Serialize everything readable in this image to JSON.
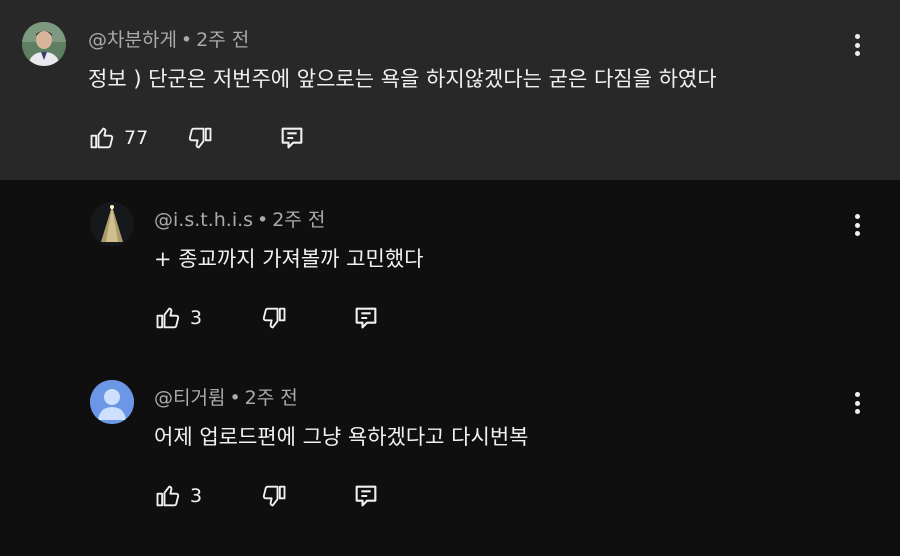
{
  "separator": "•",
  "comments": [
    {
      "handle": "@차분하게",
      "time": "2주 전",
      "text": "정보 )  단군은 저번주에 앞으로는 욕을 하지않겠다는 굳은 다짐을 하였다",
      "likes": "77"
    },
    {
      "handle": "@i.s.t.h.i.s",
      "time": "2주 전",
      "text": "+ 종교까지 가져볼까 고민했다",
      "likes": "3"
    },
    {
      "handle": "@티거륌",
      "time": "2주 전",
      "text": "어제 업로드편에 그냥 욕하겠다고 다시번복",
      "likes": "3"
    }
  ],
  "colors": {
    "top_bg": "#282828",
    "page_bg": "#0f0f0f",
    "text": "#f1f1f1",
    "meta": "#aaaaaa",
    "default_avatar": "#5b8be0"
  },
  "icons": [
    "like-icon",
    "dislike-icon",
    "reply-icon",
    "more-vert-icon"
  ]
}
